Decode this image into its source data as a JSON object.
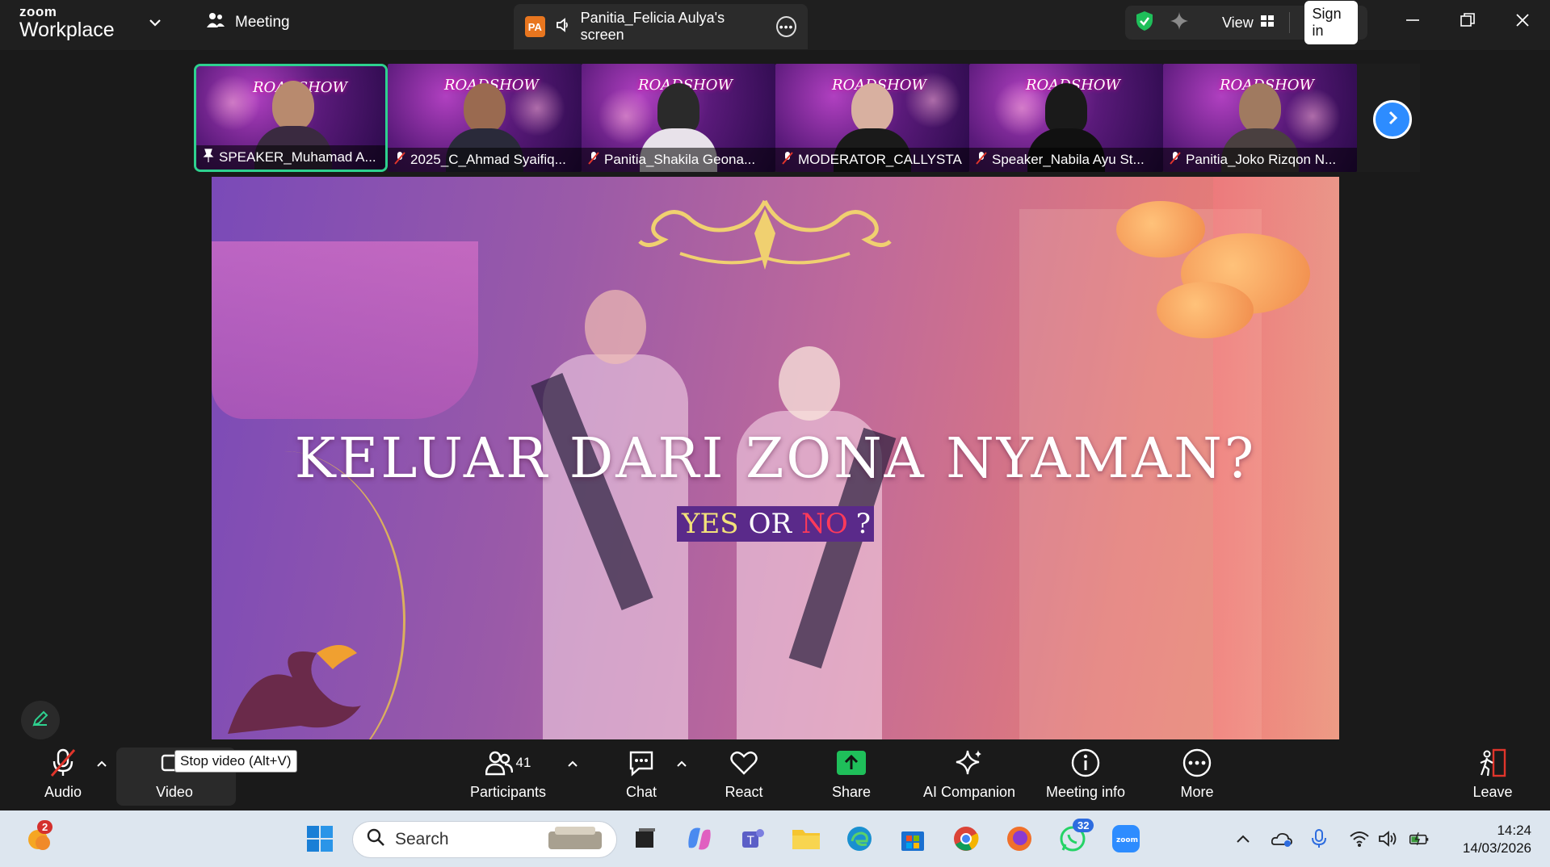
{
  "app": {
    "brand_top": "zoom",
    "brand_bottom": "Workplace",
    "meeting_tab": "Meeting",
    "share_badge": "PA",
    "share_title": "Panitia_Felicia Aulya's screen",
    "view_label": "View",
    "signin_label": "Sign in"
  },
  "thumbnails": [
    {
      "name": "SPEAKER_Muhamad A...",
      "pinned": true,
      "muted": false
    },
    {
      "name": "2025_C_Ahmad Syaifiq...",
      "pinned": false,
      "muted": true
    },
    {
      "name": "Panitia_Shakila Geona...",
      "pinned": false,
      "muted": true
    },
    {
      "name": "MODERATOR_CALLYSTA",
      "pinned": false,
      "muted": true
    },
    {
      "name": "Speaker_Nabila Ayu St...",
      "pinned": false,
      "muted": true
    },
    {
      "name": "Panitia_Joko Rizqon N...",
      "pinned": false,
      "muted": true
    }
  ],
  "thumb_logo": "ROADSHOW",
  "slide": {
    "headline": "KELUAR DARI ZONA NYAMAN?",
    "yes": "YES",
    "or": "OR",
    "no": "NO",
    "qm": "?"
  },
  "toolbar": {
    "audio": "Audio",
    "video": "Video",
    "video_tooltip": "Stop video (Alt+V)",
    "participants": "Participants",
    "participants_count": "41",
    "chat": "Chat",
    "react": "React",
    "share": "Share",
    "ai": "AI Companion",
    "info": "Meeting info",
    "more": "More",
    "leave": "Leave"
  },
  "taskbar": {
    "weather_badge": "2",
    "search_placeholder": "Search",
    "whatsapp_badge": "32",
    "time": "14:24",
    "date": "14/03/2026"
  },
  "colors": {
    "accent_green": "#2ed18f",
    "share_green": "#1fbf5a",
    "zoom_blue": "#2d8cff",
    "leave_red": "#e0352b"
  }
}
